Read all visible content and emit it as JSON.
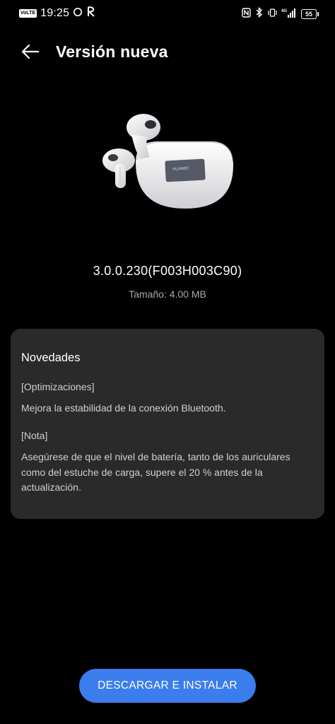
{
  "status_bar": {
    "network_badge": "VoLTE",
    "time": "19:25",
    "battery_level": "55",
    "signal_label": "4G"
  },
  "header": {
    "title": "Versión nueva"
  },
  "product": {
    "case_brand": "HUAWEI"
  },
  "update": {
    "version": "3.0.0.230(F003H003C90)",
    "size": "Tamaño: 4.00 MB"
  },
  "notes": {
    "title": "Novedades",
    "section1_heading": "[Optimizaciones]",
    "section1_text": "Mejora la estabilidad de la conexión Bluetooth.",
    "section2_heading": "[Nota]",
    "section2_text": "Asegúrese de que el nivel de batería, tanto de los auriculares como del estuche de carga, supere el 20 % antes de la actualización."
  },
  "actions": {
    "install_label": "DESCARGAR E INSTALAR"
  },
  "colors": {
    "background": "#000000",
    "card": "#2a2a2a",
    "accent": "#3b7ded"
  }
}
